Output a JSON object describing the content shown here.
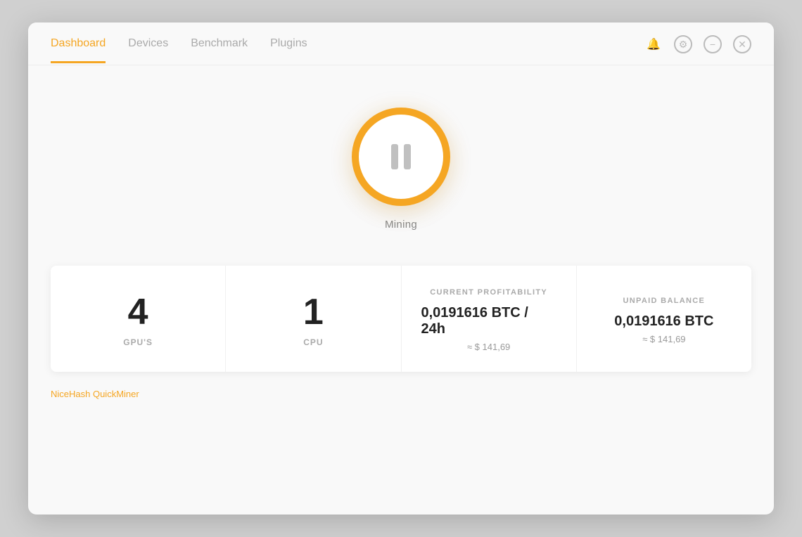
{
  "nav": {
    "tabs": [
      {
        "label": "Dashboard",
        "active": true
      },
      {
        "label": "Devices",
        "active": false
      },
      {
        "label": "Benchmark",
        "active": false
      },
      {
        "label": "Plugins",
        "active": false
      }
    ]
  },
  "controls": {
    "bell": "🔔",
    "gear": "⚙",
    "minimize": "−",
    "close": "✕"
  },
  "mining": {
    "status_label": "Mining"
  },
  "stats": {
    "gpus": {
      "value": "4",
      "label": "GPU'S"
    },
    "cpu": {
      "value": "1",
      "label": "CPU"
    },
    "profitability": {
      "section": "CURRENT PROFITABILITY",
      "value": "0,0191616 BTC / 24h",
      "usd": "≈ $ 141,69"
    },
    "balance": {
      "section": "UNPAID BALANCE",
      "value": "0,0191616 BTC",
      "usd": "≈ $ 141,69"
    }
  },
  "bottom": {
    "hint": "NiceHash QuickMiner"
  }
}
